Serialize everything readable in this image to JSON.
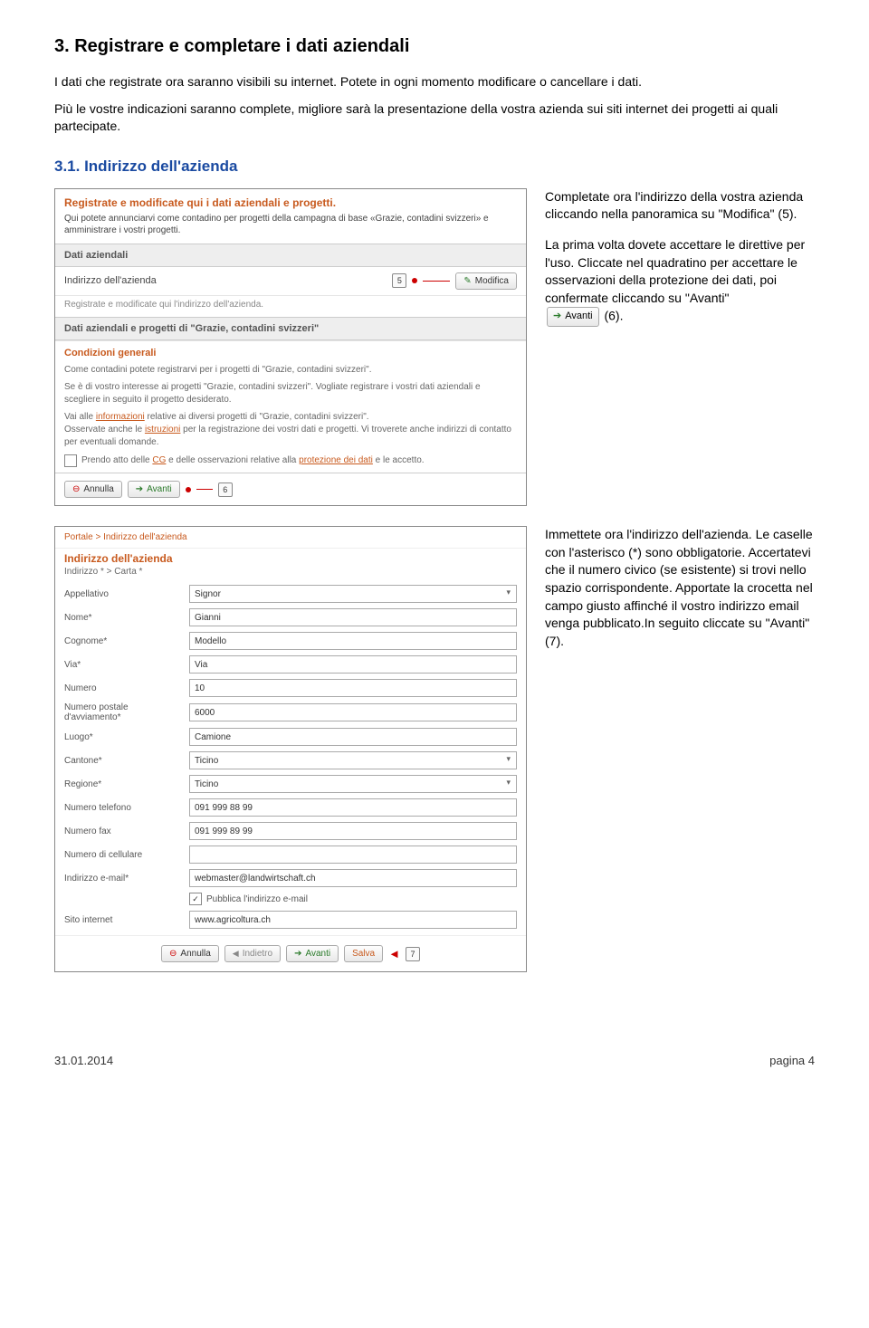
{
  "heading": "3.   Registrare e completare i dati aziendali",
  "intro1": "I dati che registrate ora saranno visibili su internet. Potete in ogni momento modificare o cancellare i dati.",
  "intro2": "Più le vostre indicazioni saranno complete, migliore sarà la presentazione della vostra azienda sui siti internet dei progetti ai quali partecipate.",
  "subheading": "3.1.   Indirizzo dell'azienda",
  "side1": {
    "p1": "Completate ora l'indirizzo della vostra azienda cliccando nella panoramica su \"Modifica\" (5).",
    "p2": "La prima volta dovete accettare le direttive per l'uso. Cliccate nel quadratino per accettare le osservazioni della protezione dei dati, poi confermate cliccando su \"Avanti\"",
    "chipLabel": "Avanti",
    "p2end": " (6)."
  },
  "side2": {
    "p1": "Immettete ora l'indirizzo dell'azienda. Le caselle con l'asterisco (*) sono obbligatorie. Accertatevi che il numero civico (se esistente) si trovi nello spazio corrispondente. Apportate la crocetta nel campo giusto affinché il vostro indirizzo email venga pubblicato.In seguito cliccate su \"Avanti\" (7)."
  },
  "shot1": {
    "headTitle": "Registrate e modificate qui i dati aziendali e progetti.",
    "headDesc": "Qui potete annunciarvi come contadino per progetti della campagna di base «Grazie, contadini svizzeri» e amministrare i vostri progetti.",
    "bar1": "Dati aziendali",
    "row1Label": "Indirizzo dell'azienda",
    "row1Marker": "5",
    "btnModifica": "Modifica",
    "row1Sub": "Registrate e modificate qui l'indirizzo dell'azienda.",
    "bar2": "Dati aziendali e progetti di \"Grazie, contadini svizzeri\"",
    "condTitle": "Condizioni generali",
    "cond1": "Come contadini potete registrarvi per i progetti di \"Grazie, contadini svizzeri\".",
    "cond2_a": "Se è di vostro interesse ai progetti \"Grazie, contadini svizzeri\". Vogliate registrare i vostri dati aziendali e scegliere in seguito il progetto desiderato.",
    "cond3_a": "Vai alle ",
    "cond3_link1": "informazioni",
    "cond3_b": " relative ai diversi progetti di \"Grazie, contadini svizzeri\".",
    "cond4_a": "Osservate anche le ",
    "cond4_link": "istruzioni",
    "cond4_b": " per la registrazione dei vostri dati e progetti. Vi troverete anche indirizzi di contatto per eventuali domande.",
    "cond5_a": "Prendo atto delle ",
    "cond5_link": "CG",
    "cond5_b": " e delle osservazioni relative alla ",
    "cond5_link2": "protezione dei dati",
    "cond5_c": " e le accetto.",
    "btnAnnulla": "Annulla",
    "btnAvanti": "Avanti",
    "marker6": "6"
  },
  "shot2": {
    "breadcrumb": "Portale > Indirizzo dell'azienda",
    "formTitle": "Indirizzo dell'azienda",
    "formSub": "Indirizzo * > Carta *",
    "fields": {
      "appellativo": {
        "label": "Appellativo",
        "value": "Signor",
        "select": true
      },
      "nome": {
        "label": "Nome*",
        "value": "Gianni"
      },
      "cognome": {
        "label": "Cognome*",
        "value": "Modello"
      },
      "via": {
        "label": "Via*",
        "value": "Via"
      },
      "numero": {
        "label": "Numero",
        "value": "10"
      },
      "cap": {
        "label": "Numero postale d'avviamento*",
        "value": "6000"
      },
      "luogo": {
        "label": "Luogo*",
        "value": "Camione"
      },
      "cantone": {
        "label": "Cantone*",
        "value": "Ticino",
        "select": true
      },
      "regione": {
        "label": "Regione*",
        "value": "Ticino",
        "select": true
      },
      "tel": {
        "label": "Numero telefono",
        "value": "091 999 88 99"
      },
      "fax": {
        "label": "Numero fax",
        "value": "091 999 89 99"
      },
      "cell": {
        "label": "Numero di cellulare",
        "value": ""
      },
      "email": {
        "label": "Indirizzo e-mail*",
        "value": "webmaster@landwirtschaft.ch"
      },
      "pubblica": {
        "label": "",
        "check": true,
        "value": "Pubblica l'indirizzo e-mail"
      },
      "sito": {
        "label": "Sito internet",
        "value": "www.agricoltura.ch"
      }
    },
    "btnAnnulla": "Annulla",
    "btnIndietro": "Indietro",
    "btnAvanti": "Avanti",
    "btnSalva": "Salva",
    "marker7": "7"
  },
  "footer": {
    "date": "31.01.2014",
    "page": "pagina 4"
  }
}
